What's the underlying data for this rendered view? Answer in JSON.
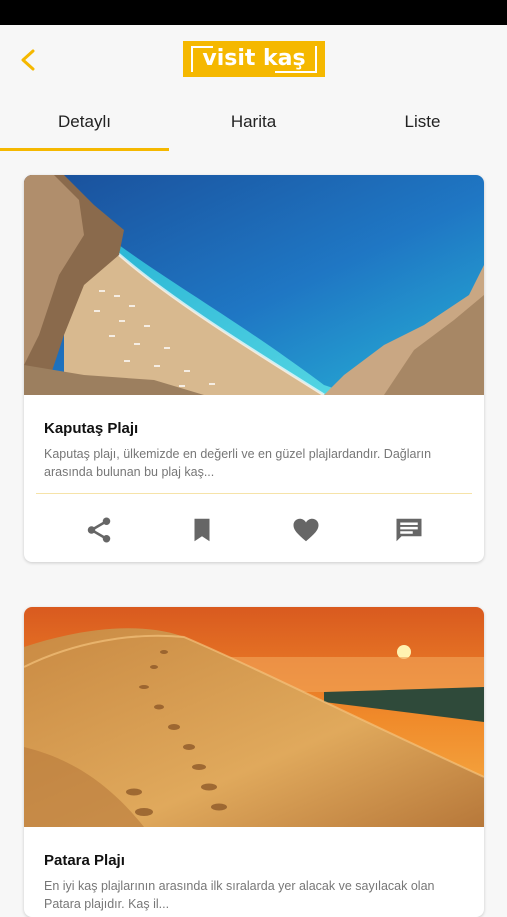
{
  "app": {
    "logo_text": "visit kaş",
    "back_icon": "chevron-left-icon",
    "accent_color": "#f5b800"
  },
  "tabs": [
    {
      "label": "Detaylı",
      "active": true
    },
    {
      "label": "Harita",
      "active": false
    },
    {
      "label": "Liste",
      "active": false
    }
  ],
  "places": [
    {
      "title": "Kaputaş Plajı",
      "description": "Kaputaş plajı, ülkemizde en değerli ve en güzel plajlardandır. Dağların arasında bulunan bu plaj kaş...",
      "actions": [
        "share-icon",
        "bookmark-icon",
        "heart-icon",
        "comment-icon"
      ]
    },
    {
      "title": "Patara Plajı",
      "description": "En iyi kaş plajlarının arasında ilk sıralarda yer alacak ve sayılacak olan Patara plajıdır. Kaş il..."
    }
  ]
}
